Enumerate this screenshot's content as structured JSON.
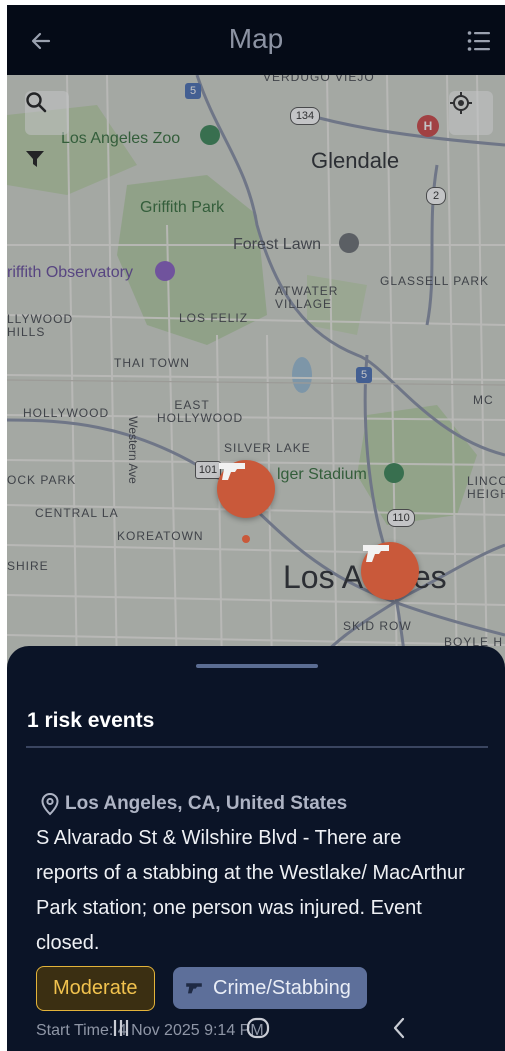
{
  "header": {
    "title": "Map",
    "back_icon": "arrow-left-icon",
    "list_icon": "list-icon"
  },
  "map": {
    "controls": [
      "search-icon",
      "filter-icon",
      "crosshair-icon"
    ],
    "labels": {
      "verdugo_viejo": "VERDUGO VIEJO",
      "la_zoo": "Los Angeles Zoo",
      "glendale": "Glendale",
      "griffith_park": "Griffith Park",
      "forest_lawn": "Forest Lawn",
      "griffith_observatory": "riffith Observatory",
      "glassell_park": "GLASSELL PARK",
      "atwater_village": "ATWATER VILLAGE",
      "hollywood_hills": "LLYWOOD HILLS",
      "los_feliz": "LOS FELIZ",
      "thai_town": "THAI TOWN",
      "hollywood": "HOLLYWOOD",
      "east_hollywood": "EAST HOLLYWOOD",
      "western_ave": "Western Ave",
      "silver_lake": "SILVER LAKE",
      "dodger_stadium": "lger Stadium",
      "rock_park": "OCK PARK",
      "lincoln_heights": "LINCO HEIGH",
      "mo": "MC",
      "central_la": "CENTRAL LA",
      "koreatown": "KOREATOWN",
      "shire": "SHIRE",
      "los_angeles": "Los A   eles",
      "skid_row": "SKID ROW",
      "boyle_heights": "BOYLE H"
    },
    "route_shields": [
      "5",
      "134",
      "2",
      "5",
      "101",
      "110"
    ],
    "hospital_badge": "H",
    "markers": [
      "handgun-icon",
      "handgun-icon"
    ]
  },
  "sheet": {
    "count_text": "1 risk events",
    "event": {
      "location": "Los Angeles, CA, United States",
      "description": "S Alvarado St & Wilshire Blvd - There are reports of a stabbing at the Westlake/ MacArthur Park station; one person was injured. Event closed.",
      "severity": "Moderate",
      "category": "Crime/Stabbing",
      "start_time": "Start Time: 4 Nov 2025 9:14 PM"
    }
  },
  "colors": {
    "sheet_bg": "#0b1427",
    "severity_accent": "#e3b33a",
    "category_bg": "#5d6f9a",
    "marker": "#c9593a"
  },
  "navbar": {
    "icons": [
      "recent-apps-icon",
      "home-icon",
      "back-icon"
    ]
  }
}
